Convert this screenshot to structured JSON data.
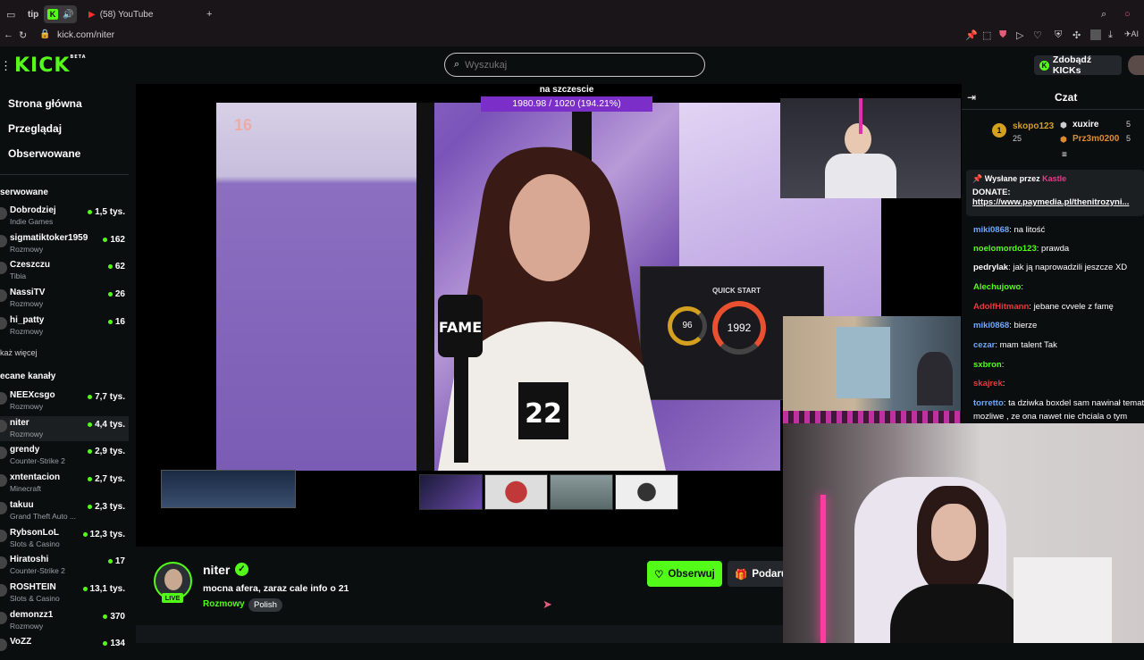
{
  "browser": {
    "tabs": [
      {
        "label": "tip"
      },
      {
        "label": "(58) YouTube"
      }
    ],
    "url": "kick.com/niter"
  },
  "header": {
    "logo": "KICK",
    "logo_badge": "BETA",
    "search_placeholder": "Wyszukaj",
    "kicks_label": "Zdobądź KICKs"
  },
  "sidebar": {
    "nav": [
      "Strona główna",
      "Przeglądaj",
      "Obserwowane"
    ],
    "followed_heading": "serwowane",
    "followed": [
      {
        "name": "Dobrodziej",
        "category": "Indie Games",
        "viewers": "1,5 tys."
      },
      {
        "name": "sigmatiktoker1959",
        "category": "Rozmowy",
        "viewers": "162"
      },
      {
        "name": "Czeszczu",
        "category": "Tibia",
        "viewers": "62"
      },
      {
        "name": "NassiTV",
        "category": "Rozmowy",
        "viewers": "26"
      },
      {
        "name": "hi_patty",
        "category": "Rozmowy",
        "viewers": "16"
      }
    ],
    "show_more": "każ więcej",
    "recommended_heading": "ecane kanały",
    "recommended": [
      {
        "name": "NEEXcsgo",
        "category": "Rozmowy",
        "viewers": "7,7 tys."
      },
      {
        "name": "niter",
        "category": "Rozmowy",
        "viewers": "4,4 tys.",
        "active": true
      },
      {
        "name": "grendy",
        "category": "Counter-Strike 2",
        "viewers": "2,9 tys."
      },
      {
        "name": "xntentacion",
        "category": "Minecraft",
        "viewers": "2,7 tys."
      },
      {
        "name": "takuu",
        "category": "Grand Theft Auto ...",
        "viewers": "2,3 tys."
      },
      {
        "name": "RybsonLoL",
        "category": "Slots & Casino",
        "viewers": "12,3 tys."
      },
      {
        "name": "Hiratoshi",
        "category": "Counter-Strike 2",
        "viewers": "17"
      },
      {
        "name": "ROSHTEIN",
        "category": "Slots & Casino",
        "viewers": "13,1 tys."
      },
      {
        "name": "demonzz1",
        "category": "Rozmowy",
        "viewers": "370"
      },
      {
        "name": "VoZZ",
        "category": "",
        "viewers": "134"
      }
    ]
  },
  "player": {
    "age_rating": "16",
    "goal_title": "na szczescie",
    "goal_progress": "1980.98 / 1020 (194.21%)",
    "mic_brand": "FAME",
    "shirt_number": "22",
    "screen_label": "QUICK START",
    "gauge_values": [
      "96",
      "1992"
    ]
  },
  "stream": {
    "channel_name": "niter",
    "live_label": "LIVE",
    "title": "mocna afera, zaraz cale info o 21",
    "category": "Rozmowy",
    "language": "Polish",
    "follow_label": "Obserwuj",
    "gift_label": "Podaruj"
  },
  "chat": {
    "title": "Czat",
    "gifters": [
      {
        "name": "skopo123",
        "count": "25"
      },
      {
        "name": "xuxire",
        "count": "5"
      },
      {
        "name": "Prz3m0200",
        "count": "5"
      }
    ],
    "pinned": {
      "sent_by_label": "Wysłane przez",
      "sender": "Kastle",
      "line1": "DONATE:",
      "link": "https://www.paymedia.pl/thenitrozyni..."
    },
    "messages": [
      {
        "user": "miki0868",
        "color": "#6ea8ff",
        "text": "na litość"
      },
      {
        "user": "noelomordo123",
        "color": "#53fc18",
        "text": "prawda"
      },
      {
        "user": "pedrylak",
        "color": "#ffffff",
        "text": "jak ją naprowadzili jeszcze XD"
      },
      {
        "user": "Alechujowo",
        "color": "#53fc18",
        "text": ""
      },
      {
        "user": "AdolfHitmann",
        "color": "#e83a3a",
        "text": "jebane cvvele z famę"
      },
      {
        "user": "miki0868",
        "color": "#6ea8ff",
        "text": "bierze"
      },
      {
        "user": "cezar",
        "color": "#6ea8ff",
        "text": "mam talent Tak"
      },
      {
        "user": "sxbron",
        "color": "#53fc18",
        "text": ""
      },
      {
        "user": "skajrek",
        "color": "#e83a3a",
        "text": ""
      },
      {
        "user": "torretto",
        "color": "#6ea8ff",
        "text": "ta dziwka boxdel sam nawinał temat"
      },
      {
        "user": "",
        "color": "#ffffff",
        "text": "mozliwe , ze ona nawet nie chciala o tym"
      }
    ]
  },
  "colors": {
    "brand": "#53fc18",
    "background": "#0b0e0f",
    "goal_bar": "#7b2ec8"
  }
}
